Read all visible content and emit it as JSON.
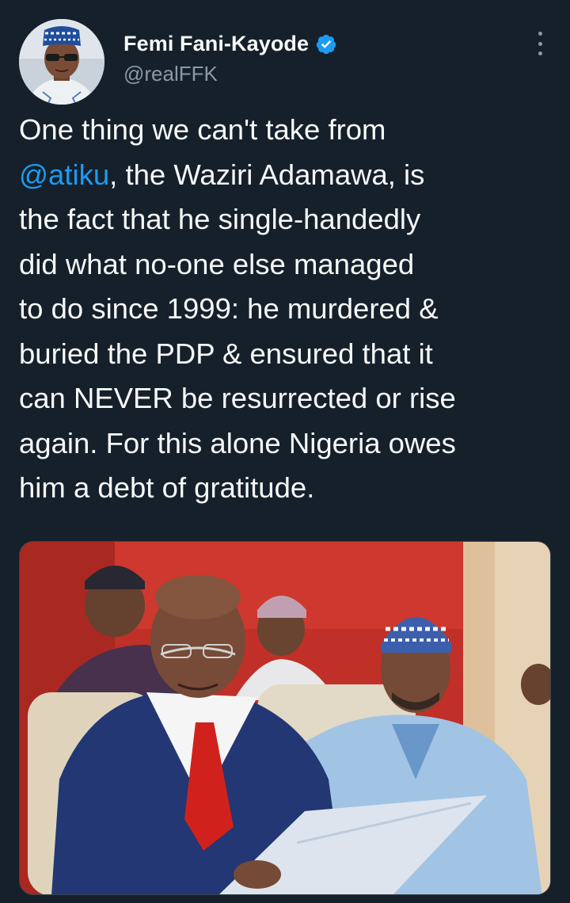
{
  "tweet": {
    "author": {
      "display_name": "Femi Fani-Kayode",
      "handle": "@realFFK",
      "verified": true
    },
    "text": {
      "line1_before": "One thing we can't take from",
      "mention": "@atiku",
      "after_mention": ", the Waziri Adamawa, is\nthe fact that he single-handedly\ndid what no-one else managed\nto do since 1999: he murdered &\nburied the PDP & ensured that it\ncan NEVER be resurrected or rise\nagain. For this alone Nigeria owes\nhim a debt of gratitude."
    },
    "media": {
      "type": "photo"
    }
  },
  "icons": {
    "verified": "verified-badge-icon",
    "more": "more-options-icon"
  },
  "colors": {
    "background": "#15202b",
    "text": "#f7f9f9",
    "secondary_text": "#8b98a5",
    "link": "#1d9bf0",
    "verified": "#1d9bf0"
  }
}
